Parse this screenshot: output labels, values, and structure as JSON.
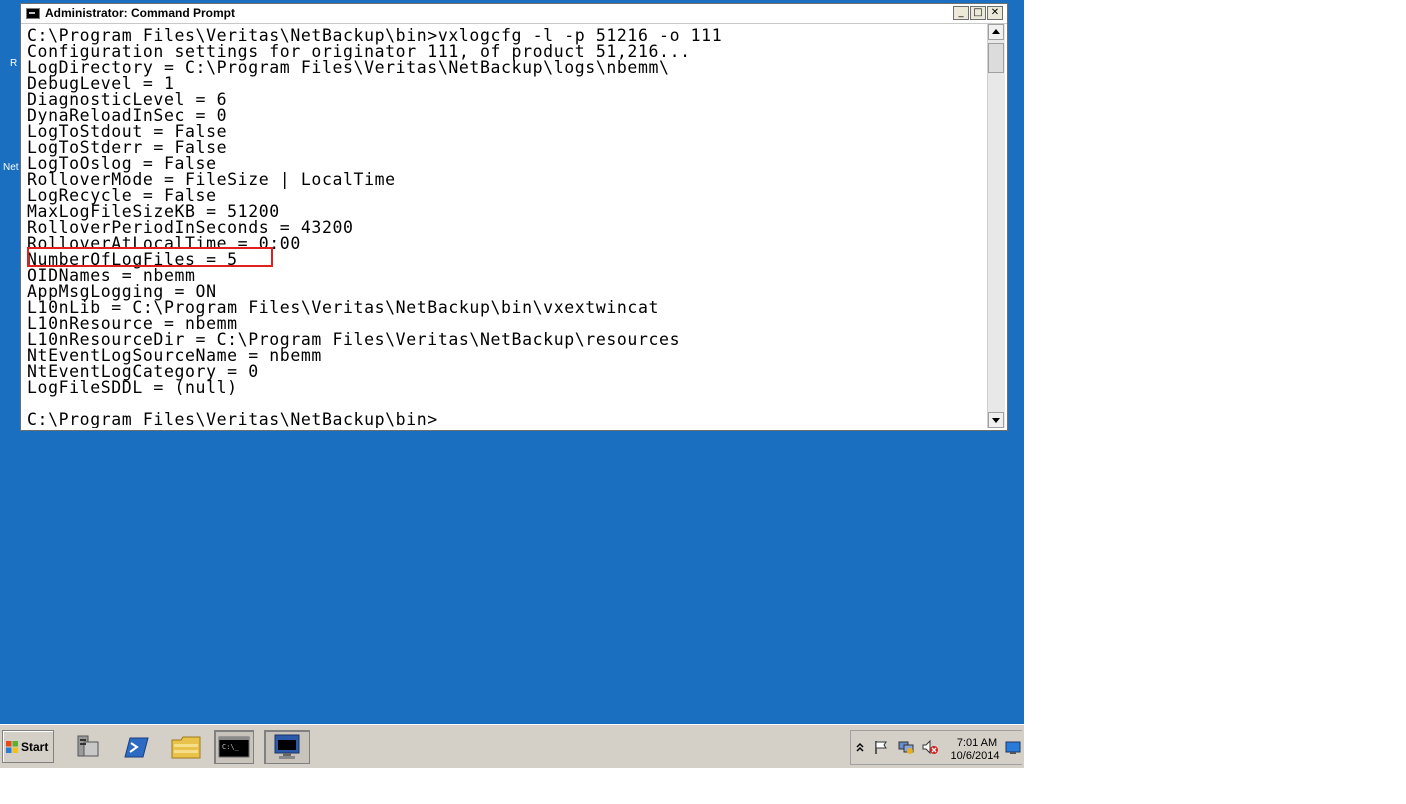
{
  "window": {
    "title": "Administrator: Command Prompt",
    "minimize_glyph": "_",
    "maximize_glyph": "□",
    "close_glyph": "✕"
  },
  "console": {
    "lines": [
      "C:\\Program Files\\Veritas\\NetBackup\\bin>vxlogcfg -l -p 51216 -o 111",
      "Configuration settings for originator 111, of product 51,216...",
      "LogDirectory = C:\\Program Files\\Veritas\\NetBackup\\logs\\nbemm\\",
      "DebugLevel = 1",
      "DiagnosticLevel = 6",
      "DynaReloadInSec = 0",
      "LogToStdout = False",
      "LogToStderr = False",
      "LogToOslog = False",
      "RolloverMode = FileSize | LocalTime",
      "LogRecycle = False",
      "MaxLogFileSizeKB = 51200",
      "RolloverPeriodInSeconds = 43200",
      "RolloverAtLocalTime = 0:00",
      "NumberOfLogFiles = 5",
      "OIDNames = nbemm",
      "AppMsgLogging = ON",
      "L10nLib = C:\\Program Files\\Veritas\\NetBackup\\bin\\vxextwincat",
      "L10nResource = nbemm",
      "L10nResourceDir = C:\\Program Files\\Veritas\\NetBackup\\resources",
      "NtEventLogSourceName = nbemm",
      "NtEventLogCategory = 0",
      "LogFileSDDL = (null)",
      "",
      "C:\\Program Files\\Veritas\\NetBackup\\bin>"
    ],
    "highlighted_line_index": 14,
    "highlight_color": "#e0201c"
  },
  "desktop": {
    "background_color": "#1a6fc0",
    "partial_labels": [
      "R",
      "Net"
    ]
  },
  "taskbar": {
    "start_label": "Start",
    "icons": [
      "server-manager-icon",
      "powershell-icon",
      "explorer-folder-icon",
      "command-prompt-icon",
      "remote-desktop-icon"
    ],
    "tray": {
      "time": "7:01 AM",
      "date": "10/6/2014",
      "icons": [
        "show-hidden-icons-chevron",
        "action-center-flag-icon",
        "network-icon",
        "volume-muted-icon",
        "show-desktop-icon"
      ]
    }
  }
}
